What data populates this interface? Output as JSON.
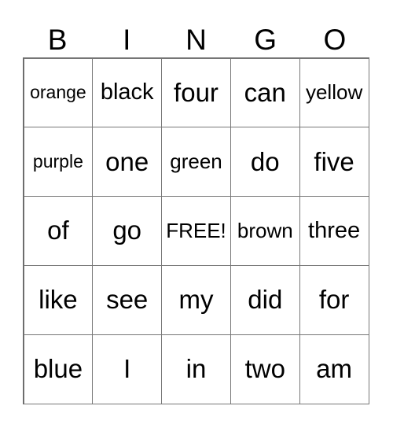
{
  "header": [
    "B",
    "I",
    "N",
    "G",
    "O"
  ],
  "cells": [
    [
      "orange",
      "black",
      "four",
      "can",
      "yellow"
    ],
    [
      "purple",
      "one",
      "green",
      "do",
      "five"
    ],
    [
      "of",
      "go",
      "FREE!",
      "brown",
      "three"
    ],
    [
      "like",
      "see",
      "my",
      "did",
      "for"
    ],
    [
      "blue",
      "I",
      "in",
      "two",
      "am"
    ]
  ]
}
